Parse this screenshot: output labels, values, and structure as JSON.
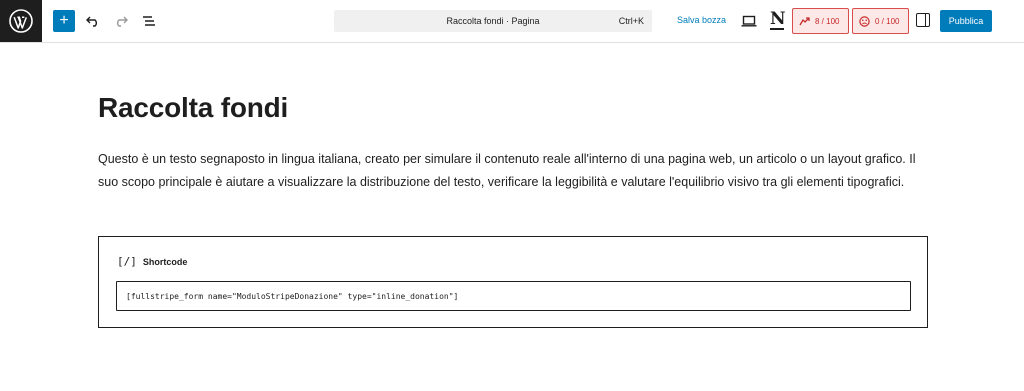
{
  "toolbar": {
    "add_label": "+",
    "document_title": "Raccolta fondi · Pagina",
    "document_shortcut": "Ctrl+K",
    "save_draft": "Salva bozza",
    "n_logo": "N",
    "score1": "8 / 100",
    "score2": "0 / 100",
    "publish": "Pubblica"
  },
  "colors": {
    "accent": "#007cba",
    "score_border": "#d94c4c",
    "score_bg": "#fde8e8"
  },
  "content": {
    "title": "Raccolta fondi",
    "paragraph": "Questo è un testo segnaposto in lingua italiana, creato per simulare il contenuto reale all'interno di una pagina web, un articolo o un layout grafico. Il suo scopo principale è aiutare a visualizzare la distribuzione del testo, verificare la leggibilità e valutare l'equilibrio visivo tra gli elementi tipografici.",
    "shortcode": {
      "icon": "[/]",
      "label": "Shortcode",
      "value": "[fullstripe_form name=\"ModuloStripeDonazione\" type=\"inline_donation\"]"
    }
  },
  "icons": [
    "wordpress-logo-icon",
    "undo-icon",
    "redo-icon",
    "document-overview-icon",
    "desktop-preview-icon",
    "sidebar-toggle-icon"
  ]
}
